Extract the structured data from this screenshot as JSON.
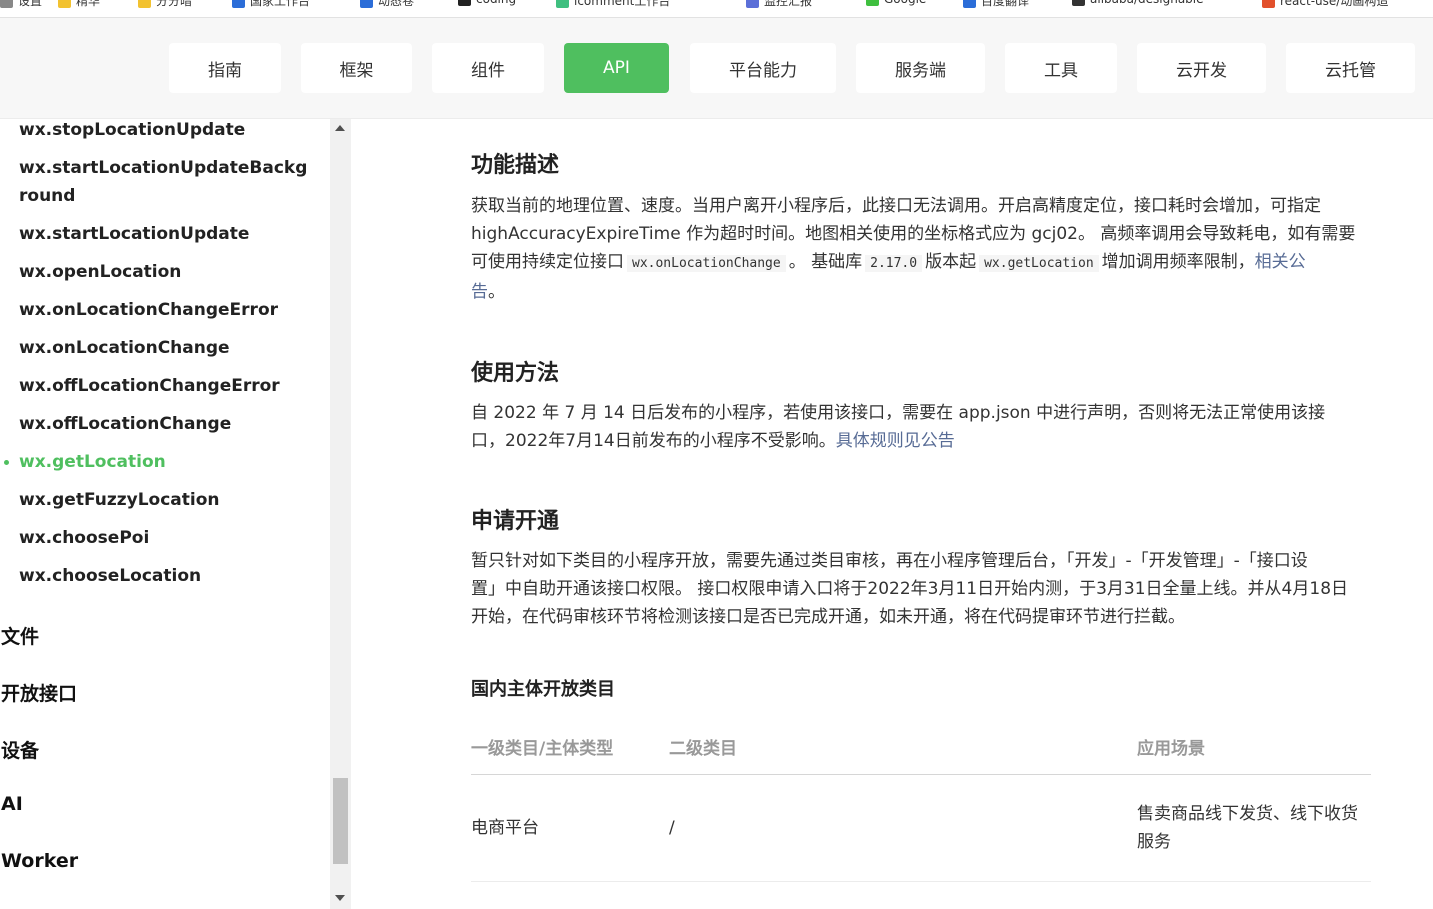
{
  "bookmarks": [
    {
      "label": "设置",
      "color": "#888888"
    },
    {
      "label": "精华",
      "color": "#f2c230"
    },
    {
      "label": "分分暗",
      "color": "#f2c230"
    },
    {
      "label": "国家工作台",
      "color": "#2b6dd8"
    },
    {
      "label": "动态卷",
      "color": "#2b6dd8"
    },
    {
      "label": "coding",
      "color": "#222222"
    },
    {
      "label": "icomment工作台",
      "color": "#3fbf7f"
    },
    {
      "label": "监控汇报",
      "color": "#5b6fd8"
    },
    {
      "label": "Google",
      "color": "#3fbf3f"
    },
    {
      "label": "百度翻译",
      "color": "#2b6dd8"
    },
    {
      "label": "alibaba/designable",
      "color": "#333333"
    },
    {
      "label": "react-use/动画构造",
      "color": "#e2502b"
    }
  ],
  "nav": {
    "tabs": [
      {
        "label": "指南"
      },
      {
        "label": "框架"
      },
      {
        "label": "组件"
      },
      {
        "label": "API",
        "active": true
      },
      {
        "label": "平台能力"
      },
      {
        "label": "服务端"
      },
      {
        "label": "工具"
      },
      {
        "label": "云开发"
      },
      {
        "label": "云托管"
      }
    ]
  },
  "sidebar": {
    "items": [
      {
        "label": "wx.stopLocationUpdate"
      },
      {
        "label": "wx.startLocationUpdateBackground"
      },
      {
        "label": "wx.startLocationUpdate"
      },
      {
        "label": "wx.openLocation"
      },
      {
        "label": "wx.onLocationChangeError"
      },
      {
        "label": "wx.onLocationChange"
      },
      {
        "label": "wx.offLocationChangeError"
      },
      {
        "label": "wx.offLocationChange"
      },
      {
        "label": "wx.getLocation",
        "active": true
      },
      {
        "label": "wx.getFuzzyLocation"
      },
      {
        "label": "wx.choosePoi"
      },
      {
        "label": "wx.chooseLocation"
      }
    ],
    "categories": [
      {
        "label": "文件"
      },
      {
        "label": "开放接口"
      },
      {
        "label": "设备"
      },
      {
        "label": "AI"
      },
      {
        "label": "Worker"
      }
    ]
  },
  "content": {
    "section1": {
      "title": "功能描述",
      "line1": "获取当前的地理位置、速度。当用户离开小程序后，此接口无法调用。开启高精度定位，接口耗时会增加，可指定",
      "line2": "highAccuracyExpireTime 作为超时时间。地图相关使用的坐标格式应为 gcj02。 高频率调用会导致耗电，如有需要",
      "line3_pre": "可使用持续定位接口",
      "code1": "wx.onLocationChange",
      "line3_mid1": "。 基础库",
      "code2": "2.17.0",
      "line3_mid2": "版本起",
      "code3": "wx.getLocation",
      "line3_post": "增加调用频率限制，",
      "link_part1": "相关公",
      "link_part2": "告",
      "line4_end": "。"
    },
    "section2": {
      "title": "使用方法",
      "line1": "自 2022 年 7 月 14 日后发布的小程序，若使用该接口，需要在 app.json 中进行声明，否则将无法正常使用该接",
      "line2_pre": "口，2022年7月14日前发布的小程序不受影响。",
      "link": "具体规则见公告"
    },
    "section3": {
      "title": "申请开通",
      "line1": "暂只针对如下类目的小程序开放，需要先通过类目审核，再在小程序管理后台，「开发」-「开发管理」-「接口设",
      "line2": "置」中自助开通该接口权限。 接口权限申请入口将于2022年3月11日开始内测，于3月31日全量上线。并从4月18日",
      "line3": "开始，在代码审核环节将检测该接口是否已完成开通，如未开通，将在代码提审环节进行拦截。"
    },
    "table_title": "国内主体开放类目",
    "table": {
      "headers": [
        "一级类目/主体类型",
        "二级类目",
        "应用场景"
      ],
      "rows": [
        {
          "c1": "电商平台",
          "c2": "/",
          "c3_line1": "售卖商品线下发货、线下收货",
          "c3_line2": "服务"
        }
      ]
    }
  },
  "colors": {
    "accent": "#4fbf5f",
    "link": "#576b95"
  }
}
